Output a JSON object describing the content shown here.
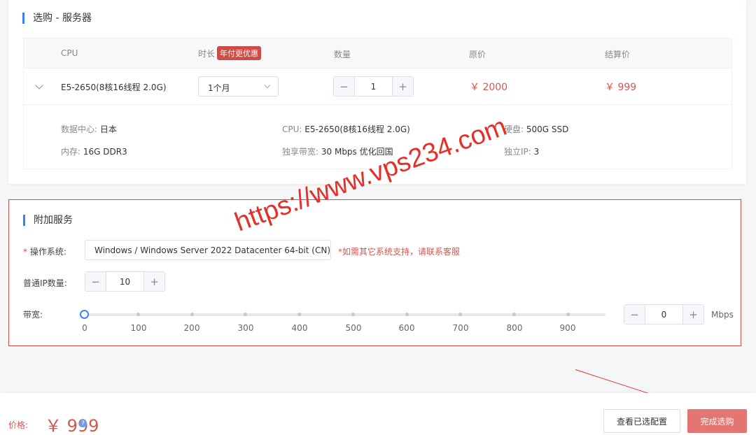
{
  "server_section": {
    "title": "选购 - 服务器",
    "columns": {
      "cpu": "CPU",
      "duration": "时长",
      "duration_badge": "年付更优惠",
      "quantity": "数量",
      "original_price": "原价",
      "final_price": "结算价"
    },
    "row": {
      "cpu": "E5-2650(8核16线程 2.0G)",
      "duration": "1个月",
      "quantity": "1",
      "original_price": "￥ 2000",
      "final_price": "￥ 999"
    },
    "details": {
      "datacenter_label": "数据中心:",
      "datacenter": "日本",
      "cpu_label": "CPU:",
      "cpu": "E5-2650(8核16线程 2.0G)",
      "disk_label": "硬盘:",
      "disk": "500G SSD",
      "memory_label": "内存:",
      "memory": "16G DDR3",
      "bandwidth_label": "独享带宽:",
      "bandwidth": "30 Mbps 优化回国",
      "ip_label": "独立IP:",
      "ip": "3"
    }
  },
  "addon_section": {
    "title": "附加服务",
    "os_label": "操作系统:",
    "os_required_mark": "*",
    "os_value": "Windows / Windows Server 2022 Datacenter 64-bit (CN)",
    "os_note": "*如需其它系统支持，请联系客服",
    "ip_label": "普通IP数量:",
    "ip_value": "10",
    "bandwidth_label": "带宽:",
    "bandwidth_ticks": [
      "0",
      "100",
      "200",
      "300",
      "400",
      "500",
      "600",
      "700",
      "800",
      "900"
    ],
    "bandwidth_value": "0",
    "bandwidth_unit": "Mbps"
  },
  "watermark": "https://www.vps234.com",
  "footer": {
    "price_label": "价格:",
    "price": "￥ 999",
    "help_icon": "?",
    "view_config_button": "查看已选配置",
    "done_button": "完成选购"
  },
  "colors": {
    "accent": "#3d82f0",
    "price_red": "#d5564f",
    "highlight_border": "#d94d48",
    "done_button": "#e37572"
  },
  "icons": [
    "chevron-down-icon",
    "help-icon",
    "minus-icon",
    "plus-icon"
  ]
}
